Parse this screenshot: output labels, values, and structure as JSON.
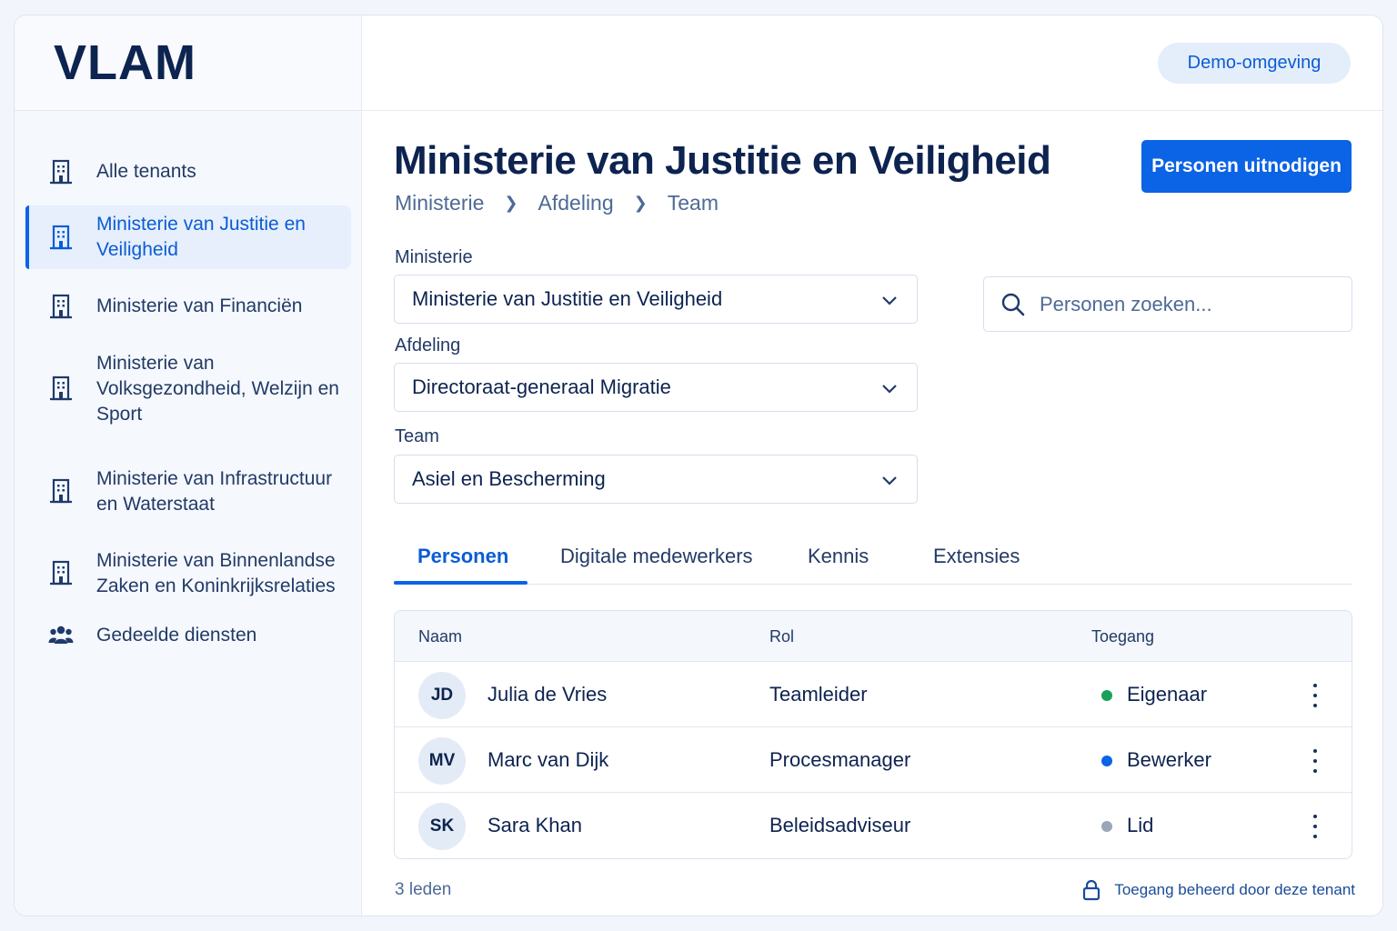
{
  "app": {
    "logo": "VLAM",
    "environment_badge": "Demo-omgeving"
  },
  "colors": {
    "accent": "#0b63e5",
    "owner": "#18a058",
    "editor": "#0b63e5",
    "member": "#9aa6b8"
  },
  "sidebar": {
    "items": [
      {
        "label": "Alle tenants",
        "icon": "building-icon",
        "active": false
      },
      {
        "label": "Ministerie van Justitie en Veiligheid",
        "icon": "building-icon",
        "active": true
      },
      {
        "label": "Ministerie van Financiën",
        "icon": "building-icon",
        "active": false
      },
      {
        "label": "Ministerie van Volksgezondheid, Welzijn en Sport",
        "icon": "building-icon",
        "active": false
      },
      {
        "label": "Ministerie van Infrastructuur en Waterstaat",
        "icon": "building-icon",
        "active": false
      },
      {
        "label": "Ministerie van Binnenlandse Zaken en Koninkrijksrelaties",
        "icon": "building-icon",
        "active": false
      },
      {
        "label": "Gedeelde diensten",
        "icon": "users-icon",
        "active": false
      }
    ]
  },
  "main": {
    "title": "Ministerie van Justitie en Veiligheid",
    "invite_button": "Personen uitnodigen",
    "breadcrumb": [
      "Ministerie",
      "Afdeling",
      "Team"
    ],
    "fields": {
      "ministry": {
        "label": "Ministerie",
        "value": "Ministerie van Justitie en Veiligheid"
      },
      "department": {
        "label": "Afdeling",
        "value": "Directoraat-generaal Migratie"
      },
      "team": {
        "label": "Team",
        "value": "Asiel en Bescherming"
      }
    },
    "search": {
      "placeholder": "Personen zoeken..."
    },
    "tabs": [
      "Personen",
      "Digitale medewerkers",
      "Kennis",
      "Extensies"
    ],
    "table": {
      "headers": [
        "Naam",
        "Rol",
        "Toegang"
      ],
      "rows": [
        {
          "initials": "JD",
          "name": "Julia de Vries",
          "role": "Teamleider",
          "access": "Eigenaar"
        },
        {
          "initials": "MV",
          "name": "Marc van Dijk",
          "role": "Procesmanager",
          "access": "Bewerker"
        },
        {
          "initials": "SK",
          "name": "Sara Khan",
          "role": "Beleidsadviseur",
          "access": "Lid"
        }
      ]
    },
    "member_count": "3 leden",
    "access_note": "Toegang beheerd door deze tenant"
  }
}
